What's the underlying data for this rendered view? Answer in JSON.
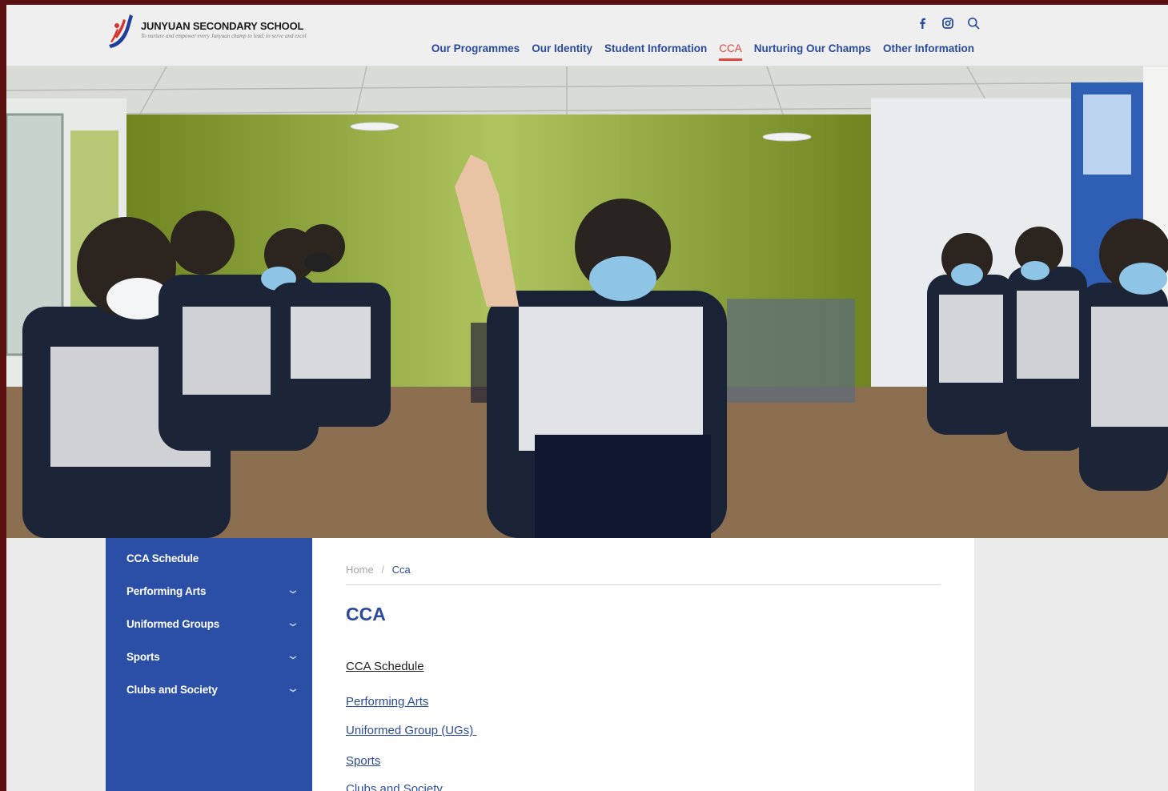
{
  "header": {
    "school_name": "JUNYUAN SECONDARY SCHOOL",
    "tagline": "To nurture and empower every Junyuan champ to lead, to serve and excel",
    "social": [
      {
        "icon": "facebook-icon"
      },
      {
        "icon": "instagram-icon"
      },
      {
        "icon": "search-icon"
      }
    ],
    "nav": [
      {
        "label": "Our Programmes"
      },
      {
        "label": "Our Identity"
      },
      {
        "label": "Student Information"
      },
      {
        "label": "CCA",
        "active": true
      },
      {
        "label": "Nurturing Our Champs"
      },
      {
        "label": "Other Information"
      }
    ]
  },
  "sidebar": {
    "items": [
      {
        "label": "CCA Schedule",
        "expandable": false
      },
      {
        "label": "Performing Arts",
        "expandable": true
      },
      {
        "label": "Uniformed Groups",
        "expandable": true
      },
      {
        "label": "Sports",
        "expandable": true
      },
      {
        "label": "Clubs and Society",
        "expandable": true
      }
    ]
  },
  "content": {
    "breadcrumb": {
      "home": "Home",
      "separator": "/",
      "current": "Cca"
    },
    "title": "CCA",
    "links": [
      {
        "label": "CCA Schedule"
      },
      {
        "label": "Performing Arts"
      },
      {
        "label": "Uniformed Group (UGs) "
      },
      {
        "label": "Sports"
      },
      {
        "label": "Clubs and Society"
      }
    ]
  },
  "colors": {
    "brand_blue": "#2b4fa6",
    "nav_blue": "#2a4a9c",
    "active_red": "#e0453c",
    "page_border": "#5a1010"
  }
}
